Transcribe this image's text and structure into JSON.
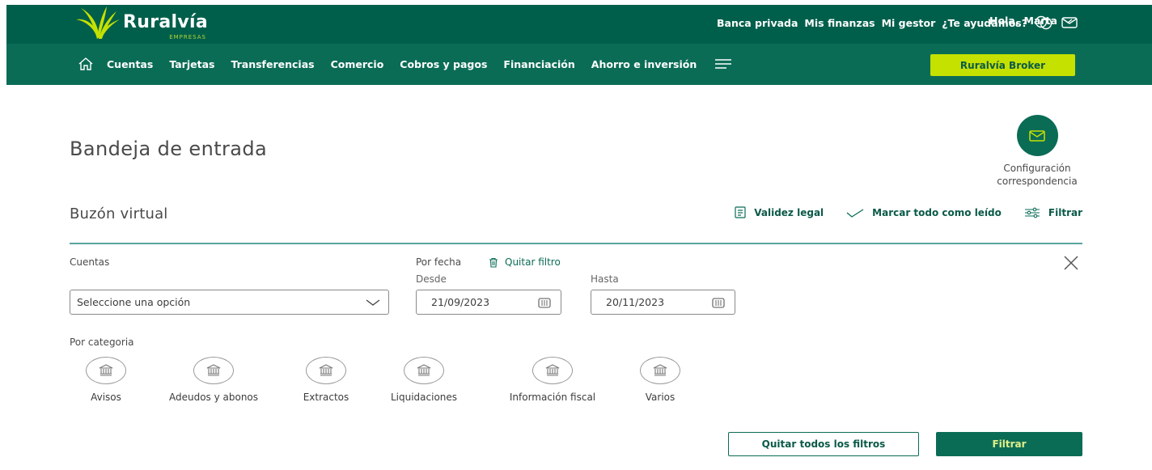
{
  "brand": {
    "name": "Ruralvía",
    "subtitle": "EMPRESAS"
  },
  "top_links": [
    "Banca privada",
    "Mis finanzas",
    "Mi gestor",
    "¿Te ayudamos?"
  ],
  "user": {
    "greeting": "Hola,",
    "name": "Marta"
  },
  "nav": {
    "items": [
      "Cuentas",
      "Tarjetas",
      "Transferencias",
      "Comercio",
      "Cobros y pagos",
      "Financiación",
      "Ahorro e inversión"
    ],
    "broker_button": "Ruralvía Broker"
  },
  "page": {
    "title": "Bandeja de entrada",
    "config_line1": "Configuración",
    "config_line2": "correspondencia"
  },
  "section": {
    "title": "Buzón virtual",
    "actions": {
      "legal": "Validez legal",
      "mark_read": "Marcar todo como leído",
      "filter": "Filtrar"
    }
  },
  "filters": {
    "accounts_label": "Cuentas",
    "accounts_placeholder": "Seleccione una opción",
    "date_label": "Por fecha",
    "clear_filter": "Quitar filtro",
    "from_label": "Desde",
    "from_value": "21/09/2023",
    "to_label": "Hasta",
    "to_value": "20/11/2023",
    "category_label": "Por categoria",
    "categories": [
      "Avisos",
      "Adeudos y abonos",
      "Extractos",
      "Liquidaciones",
      "Información fiscal",
      "Varios"
    ]
  },
  "buttons": {
    "clear_all": "Quitar todos los filtros",
    "apply": "Filtrar"
  },
  "colors": {
    "header_dark": "#005f4b",
    "header_nav": "#0b6c56",
    "accent_lime": "#c5e100",
    "primary": "#0b6c56"
  },
  "icons": [
    "ruralvia-logo",
    "home-icon",
    "menu-icon",
    "chat-icon",
    "mail-icon",
    "chevron-down-icon",
    "document-icon",
    "checkmark-icon",
    "filter-icon",
    "trash-icon",
    "calendar-icon",
    "bank-icon",
    "close-icon"
  ]
}
